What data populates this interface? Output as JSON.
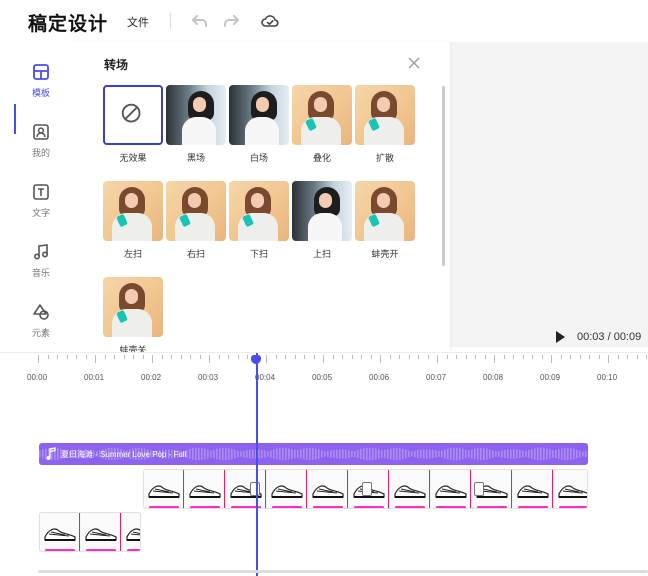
{
  "app": {
    "logo": "稿定设计",
    "file_menu": "文件"
  },
  "sidebar": {
    "items": [
      {
        "label": "模板",
        "icon": "template-icon",
        "active": true
      },
      {
        "label": "我的",
        "icon": "my-files-icon",
        "active": false
      },
      {
        "label": "文字",
        "icon": "text-icon",
        "active": false
      },
      {
        "label": "音乐",
        "icon": "music-icon",
        "active": false
      },
      {
        "label": "元素",
        "icon": "elements-icon",
        "active": false
      }
    ]
  },
  "panel": {
    "title": "转场",
    "transitions": [
      {
        "label": "无效果",
        "style": "none"
      },
      {
        "label": "黑场",
        "style": "dark"
      },
      {
        "label": "白场",
        "style": "dark"
      },
      {
        "label": "叠化",
        "style": "warm"
      },
      {
        "label": "扩散",
        "style": "warm"
      },
      {
        "label": "左扫",
        "style": "warm"
      },
      {
        "label": "右扫",
        "style": "warm"
      },
      {
        "label": "下扫",
        "style": "warm"
      },
      {
        "label": "上扫",
        "style": "dark"
      },
      {
        "label": "蚌壳开",
        "style": "warm"
      },
      {
        "label": "蚌壳关",
        "style": "warm"
      }
    ]
  },
  "player": {
    "time": "00:03 / 00:09"
  },
  "timeline": {
    "ruler_labels": [
      "00:00",
      "00:01",
      "00:02",
      "00:03",
      "00:04",
      "00:05",
      "00:06",
      "00:07",
      "00:08",
      "00:09",
      "00:10"
    ],
    "audio_label": "夏日海滩 - Summer Love Pop - Full",
    "colors": {
      "accent": "#4a4de8",
      "audio": "#8c62ee",
      "clip_marker": "#ff2fbd"
    }
  }
}
